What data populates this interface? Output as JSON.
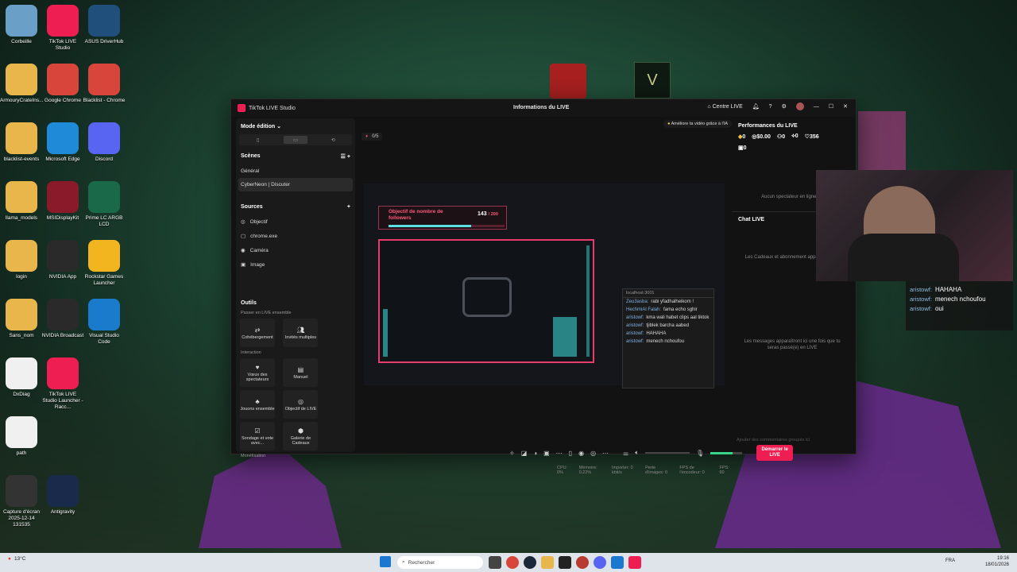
{
  "desktop": {
    "icons": [
      {
        "label": "Corbeille",
        "icon": "recycle-bin-icon",
        "color": "#6aa0c8"
      },
      {
        "label": "TikTok LIVE Studio",
        "icon": "tiktok-icon",
        "color": "#ee1d52"
      },
      {
        "label": "ASUS DriverHub",
        "icon": "gear-icon",
        "color": "#1f4f7a"
      },
      {
        "label": "ArmouryCrateIns...",
        "icon": "folder-icon",
        "color": "#e8b64a"
      },
      {
        "label": "Google Chrome",
        "icon": "chrome-icon",
        "color": "#d8453a"
      },
      {
        "label": "Blacklist - Chrome",
        "icon": "chrome-icon",
        "color": "#d8453a"
      },
      {
        "label": "blacklist-events",
        "icon": "folder-icon",
        "color": "#e8b64a"
      },
      {
        "label": "Microsoft Edge",
        "icon": "edge-icon",
        "color": "#1e8ad8"
      },
      {
        "label": "Discord",
        "icon": "discord-icon",
        "color": "#5865f2"
      },
      {
        "label": "llama_models",
        "icon": "folder-icon",
        "color": "#e8b64a"
      },
      {
        "label": "MSIDisplayKit",
        "icon": "msi-icon",
        "color": "#8a1a2a"
      },
      {
        "label": "Prime LC ARGB LCD",
        "icon": "prime-icon",
        "color": "#1a6a4a"
      },
      {
        "label": "login",
        "icon": "folder-icon",
        "color": "#e8b64a"
      },
      {
        "label": "NVIDIA App",
        "icon": "nvidia-icon",
        "color": "#2a2a2a"
      },
      {
        "label": "Rockstar Games Launcher",
        "icon": "rockstar-icon",
        "color": "#f2b51f"
      },
      {
        "label": "Sans_nom",
        "icon": "folder-icon",
        "color": "#e8b64a"
      },
      {
        "label": "NVIDIA Broadcast",
        "icon": "nvidia-icon",
        "color": "#2a2a2a"
      },
      {
        "label": "Visual Studio Code",
        "icon": "vscode-icon",
        "color": "#1a7acc"
      },
      {
        "label": "DxDiag",
        "icon": "file-icon",
        "color": "#f0f0f0"
      },
      {
        "label": "TikTok LIVE Studio Launcher - Racc...",
        "icon": "tiktok-icon",
        "color": "#ee1d52"
      },
      {
        "label": "path",
        "icon": "file-icon",
        "color": "#f0f0f0"
      },
      {
        "label": "Capture d'écran 2025-12-14 131535",
        "icon": "image-icon",
        "color": "#333"
      },
      {
        "label": "Antigravity",
        "icon": "antigravity-icon",
        "color": "#1a2a4a"
      }
    ]
  },
  "window": {
    "title": "TikTok LIVE Studio",
    "center_title": "Informations du LIVE",
    "centre_live": "Centre LIVE"
  },
  "left": {
    "mode": "Mode édition",
    "scenes_h": "Scènes",
    "scenes": [
      "Général",
      "CyberNeon | Discuter"
    ],
    "sources_h": "Sources",
    "sources": [
      "Objectif",
      "chrome.exe",
      "Caméra",
      "Image"
    ],
    "outils_h": "Outils",
    "passer": "Passer en LIVE ensemble",
    "tools1": [
      "Cohébergement",
      "Invités multiples"
    ],
    "interaction": "Interaction",
    "tools2": [
      "Vœux des spectateurs",
      "Manuel",
      "Jouons ensemble"
    ],
    "tools3": [
      "Objectif de LIVE",
      "Sondage et vote avec...",
      "Galerie de Cadeaux"
    ],
    "monet": "Monétisation"
  },
  "center": {
    "count": "0/5",
    "ai": "Améliore ta vidéo grâce à l'IA",
    "objective": "Objectif de nombre de followers",
    "obj_value": "143",
    "obj_total": "200",
    "localhost": "localhost:3001",
    "chat": [
      {
        "user": "Zeu3asba:",
        "msg": "rabi yfadhalheikom !"
      },
      {
        "user": "HechmiAl Falah:",
        "msg": "fama echo sghir"
      },
      {
        "user": "aristowf:",
        "msg": "kma wali habet clips aal tiktok"
      },
      {
        "user": "aristowf:",
        "msg": "tjiblek barcha aabed"
      },
      {
        "user": "aristowf:",
        "msg": "HAHAHA"
      },
      {
        "user": "aristowf:",
        "msg": "menech nchoufou"
      }
    ],
    "start": "Démarrer le LIVE",
    "stats": [
      "CPU: 0%",
      "Mémoire: 0.22%",
      "Importer: 0 kbit/s",
      "Perte d'images: 0",
      "FPS de l'encodeur: 0",
      "FPS: 60"
    ]
  },
  "right": {
    "perf_h": "Performances du LIVE",
    "s1": "0",
    "s2": "$0.00",
    "s3": "0",
    "s4": "0",
    "s5": "356",
    "s6": "0",
    "no_viewers": "Aucun spectateur en ligne po",
    "chat_h": "Chat LIVE",
    "gifts_note": "Les Cadeaux et abonnement apparaîtront ici",
    "msgs_note": "Les messages apparaîtront ici une fois que tu seras passé(e) en LIVE",
    "comment_ph": "Ajouter des commentaires groupés ici"
  },
  "overlay_chat": [
    {
      "user": "aristowf:",
      "msg": "HAHAHA"
    },
    {
      "user": "aristowf:",
      "msg": "menech nchoufou"
    },
    {
      "user": "aristowf:",
      "msg": "oui"
    }
  ],
  "taskbar": {
    "weather": "13°C",
    "search": "Rechercher",
    "lang": "FRA",
    "time": "19:16",
    "date": "18/01/2026"
  }
}
